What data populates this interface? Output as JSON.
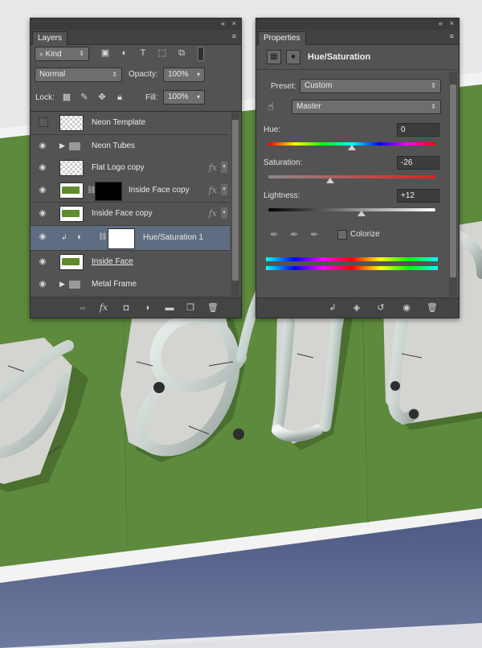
{
  "layers_panel": {
    "tab": "Layers",
    "collapse_glyph": "«",
    "close_glyph": "×",
    "menu_glyph": "≡",
    "filter": {
      "kind_label": "Kind",
      "search_icon": "search-icon"
    },
    "filter_icons": [
      "image-icon",
      "adjustment-icon",
      "type-icon",
      "shape-icon",
      "smart-object-icon"
    ],
    "blend_mode": "Normal",
    "opacity_label": "Opacity:",
    "opacity_value": "100%",
    "lock_label": "Lock:",
    "fill_label": "Fill:",
    "fill_value": "100%",
    "layers": [
      {
        "name": "Neon Template",
        "visible": false,
        "kind": "transparent",
        "fx": false
      },
      {
        "name": "Neon Tubes",
        "visible": true,
        "kind": "group",
        "fx": false
      },
      {
        "name": "Flat Logo copy",
        "visible": true,
        "kind": "logo",
        "fx": true
      },
      {
        "name": "Inside Face copy",
        "visible": true,
        "kind": "masked",
        "fx": true
      },
      {
        "name": "Inside Face copy",
        "visible": true,
        "kind": "green",
        "fx": true
      },
      {
        "name": "Hue/Saturation 1",
        "visible": true,
        "kind": "adjustment",
        "fx": false,
        "selected": true
      },
      {
        "name": "Inside Face",
        "visible": true,
        "kind": "green",
        "fx": false
      },
      {
        "name": "Metal Frame",
        "visible": true,
        "kind": "group",
        "fx": false
      }
    ],
    "fx_glyph": "fx"
  },
  "properties_panel": {
    "tab": "Properties",
    "collapse_glyph": "«",
    "close_glyph": "×",
    "menu_glyph": "≡",
    "title": "Hue/Saturation",
    "preset_label": "Preset:",
    "preset_value": "Custom",
    "channel_value": "Master",
    "hue_label": "Hue:",
    "hue_value": "0",
    "saturation_label": "Saturation:",
    "saturation_value": "-26",
    "lightness_label": "Lightness:",
    "lightness_value": "+12",
    "colorize_label": "Colorize",
    "colorize_checked": false,
    "slider_positions": {
      "hue": 0.5,
      "saturation": 0.37,
      "lightness": 0.56
    }
  },
  "colors": {
    "panel_bg": "#535353",
    "selected_row": "#5f6d82",
    "sign_green": "#5e8a3d",
    "sign_face": "#d4d4d0",
    "tube_color": "#d9dfdc"
  }
}
